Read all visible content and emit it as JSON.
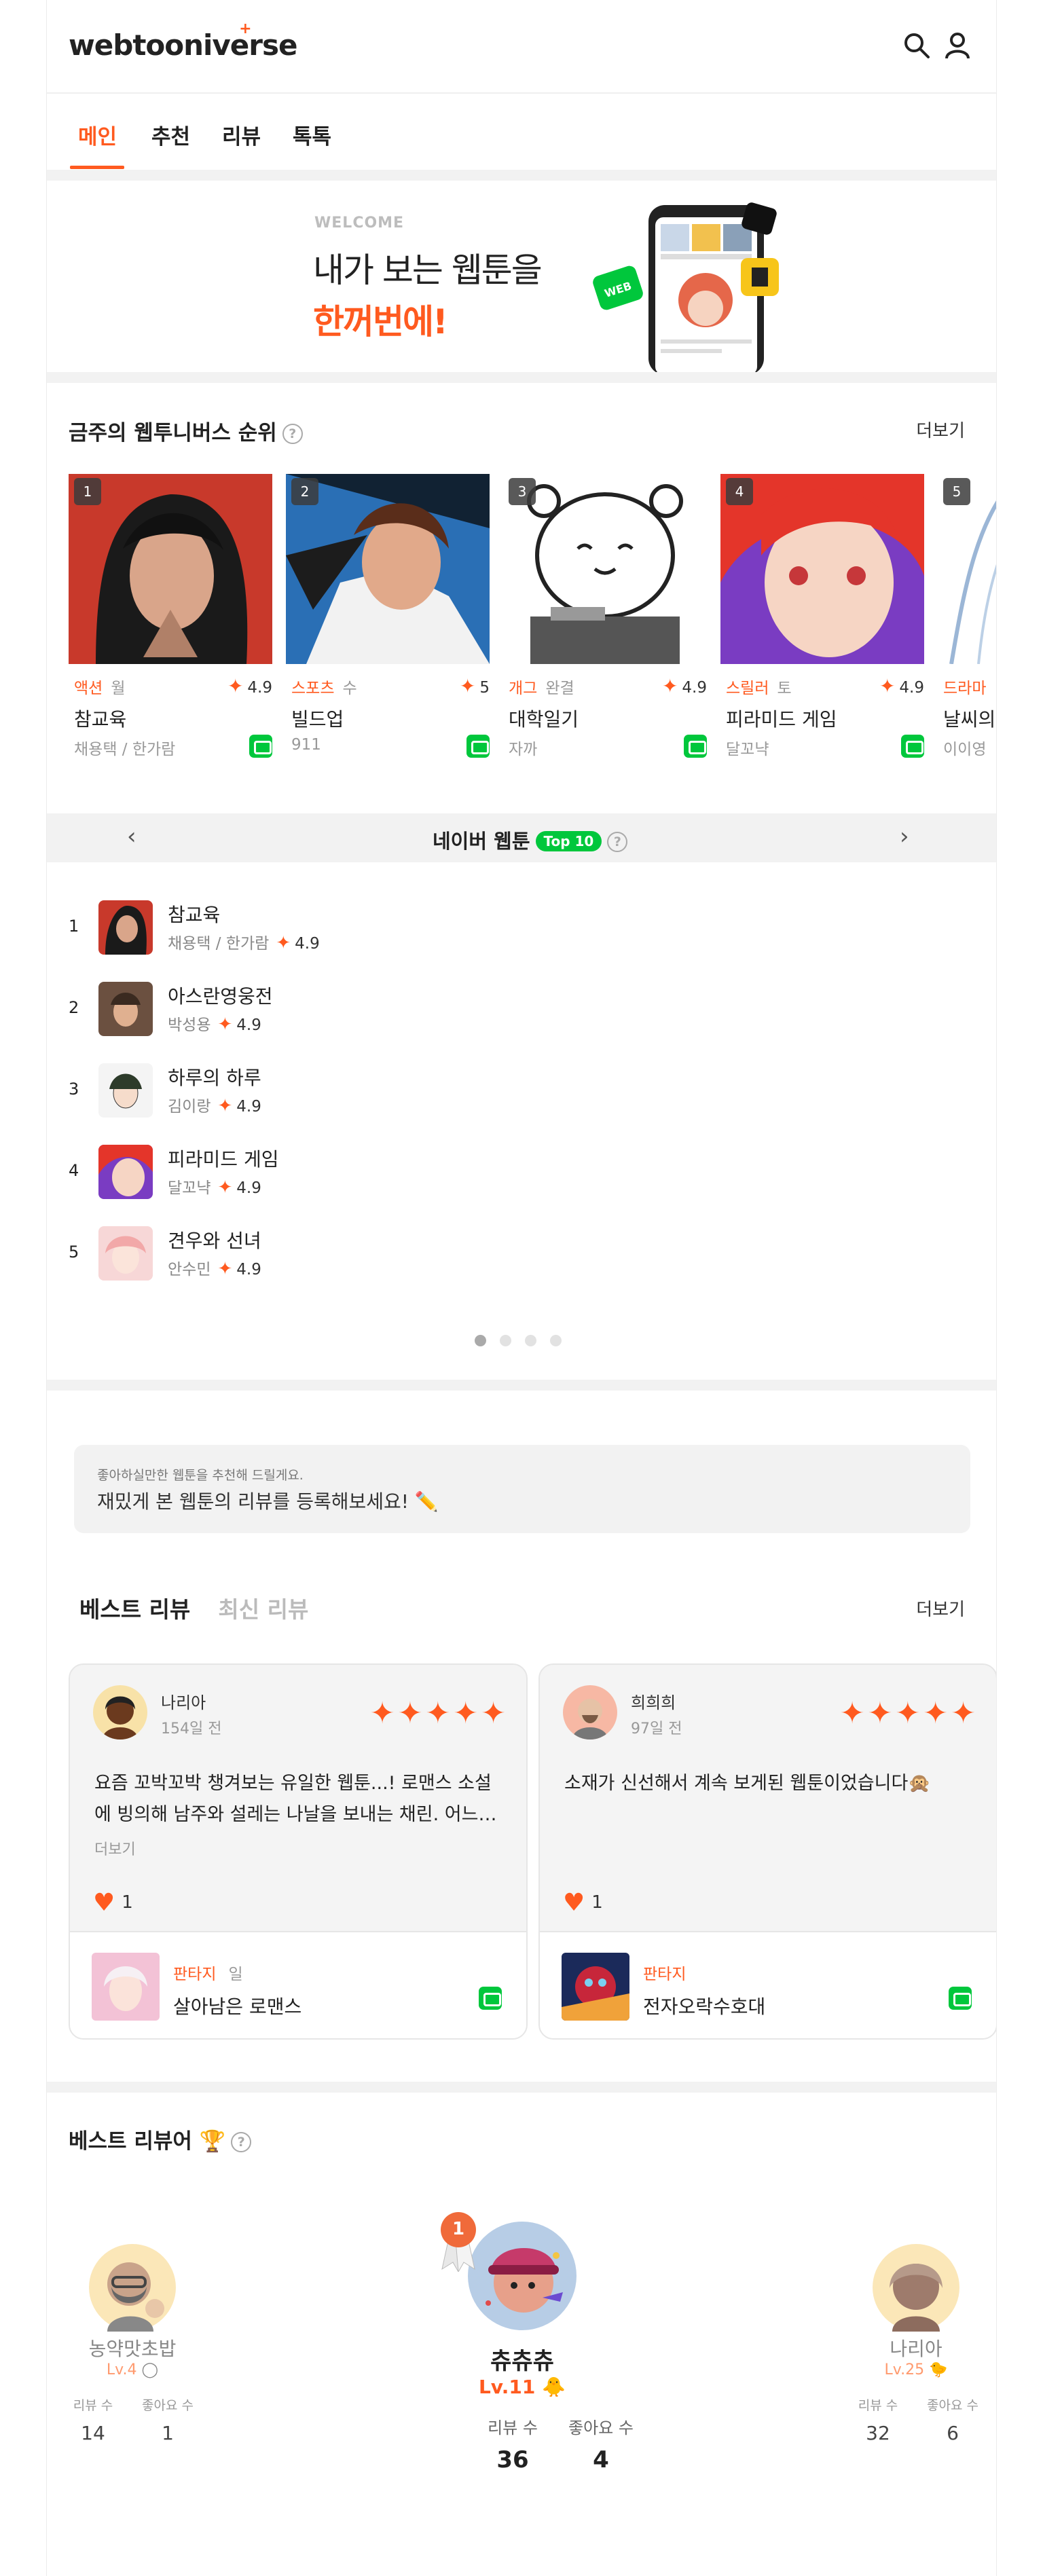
{
  "header": {
    "logo": "webtooniverse"
  },
  "nav": {
    "tabs": [
      "메인",
      "추천",
      "리뷰",
      "톡톡"
    ],
    "active": 0
  },
  "banner": {
    "welcome": "WELCOME",
    "line1": "내가 보는 웹툰을",
    "line2": "한꺼번에!"
  },
  "weekly": {
    "title": "금주의 웹투니버스 순위",
    "more": "더보기",
    "cards": [
      {
        "rank": "1",
        "genre": "액션",
        "day": "월",
        "rating": "4.9",
        "title": "참교육",
        "author": "채용택 / 한가람"
      },
      {
        "rank": "2",
        "genre": "스포츠",
        "day": "수",
        "rating": "5",
        "title": "빌드업",
        "author": "911"
      },
      {
        "rank": "3",
        "genre": "개그",
        "day": "완결",
        "rating": "4.9",
        "title": "대학일기",
        "author": "자까"
      },
      {
        "rank": "4",
        "genre": "스릴러",
        "day": "토",
        "rating": "4.9",
        "title": "피라미드 게임",
        "author": "달꼬냑"
      },
      {
        "rank": "5",
        "genre": "드라마",
        "day": "",
        "rating": "",
        "title": "날씨의",
        "author": "이이영"
      }
    ]
  },
  "naver": {
    "title": "네이버 웹툰",
    "badge": "Top 10",
    "items": [
      {
        "rank": "1",
        "title": "참교육",
        "author": "채용택 / 한가람",
        "rating": "4.9"
      },
      {
        "rank": "2",
        "title": "아스란영웅전",
        "author": "박성용",
        "rating": "4.9"
      },
      {
        "rank": "3",
        "title": "하루의 하루",
        "author": "김이랑",
        "rating": "4.9"
      },
      {
        "rank": "4",
        "title": "피라미드 게임",
        "author": "달꼬냑",
        "rating": "4.9"
      },
      {
        "rank": "5",
        "title": "견우와 선녀",
        "author": "안수민",
        "rating": "4.9"
      }
    ],
    "page_dots": 4,
    "active_dot": 0
  },
  "notice": {
    "small": "좋아하실만한 웹툰을 추천해 드릴게요.",
    "main": "재밌게 본 웹툰의 리뷰를 등록해보세요! ✏️"
  },
  "reviews": {
    "tabs": [
      "베스트 리뷰",
      "최신 리뷰"
    ],
    "more": "더보기",
    "cards": [
      {
        "name": "나리아",
        "date": "154일 전",
        "stars": "✦✦✦✦✦",
        "text": "요즘 꼬박꼬박 챙겨보는 유일한 웹툰...! 로맨스 소설에 빙의해 남주와 설레는 나날을 보내는 채린. 어느…",
        "more": "더보기",
        "likes": "1",
        "genre": "판타지",
        "day": "일",
        "title": "살아남은 로맨스"
      },
      {
        "name": "희희희",
        "date": "97일 전",
        "stars": "✦✦✦✦✦",
        "text": "소재가 신선해서 계속 보게된 웹툰이었습니다🙊",
        "more": "",
        "likes": "1",
        "genre": "판타지",
        "day": "",
        "title": "전자오락수호대"
      }
    ]
  },
  "best_reviewers": {
    "title": "베스트 리뷰어 🏆",
    "stat_labels": {
      "reviews": "리뷰 수",
      "likes": "좋아요 수"
    },
    "left": {
      "name": "농약맛초밥",
      "level": "Lv.4",
      "reviews": "14",
      "likes": "1"
    },
    "center": {
      "rank": "1",
      "name": "츄츄츄",
      "level": "Lv.11",
      "reviews": "36",
      "likes": "4"
    },
    "right": {
      "name": "나리아",
      "level": "Lv.25",
      "reviews": "32",
      "likes": "6"
    }
  },
  "colors": {
    "accent": "#ff5a1f",
    "naver_green": "#00c73c",
    "section_bg": "#f2f2f2"
  }
}
